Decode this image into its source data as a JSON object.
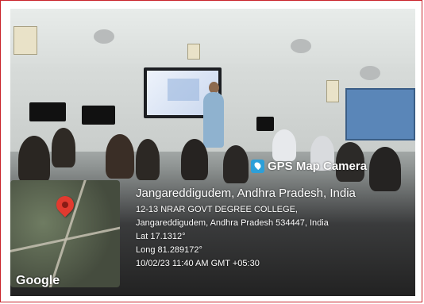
{
  "overlay": {
    "title": "GPS Map Camera",
    "location_main": "Jangareddigudem, Andhra Pradesh, India",
    "lines": [
      "12-13 NRAR GOVT DEGREE COLLEGE,",
      "Jangareddigudem, Andhra Pradesh 534447, India",
      "Lat 17.1312°",
      "Long 81.289172°",
      "10/02/23 11:40 AM GMT +05:30"
    ],
    "map_brand": "Google"
  },
  "colors": {
    "frame_border": "#c9242b",
    "pin": "#e23a2f",
    "app_icon": "#2d9fd8"
  },
  "icons": {
    "app_icon": "gps-map-camera-icon",
    "map_marker": "location-pin-icon"
  }
}
